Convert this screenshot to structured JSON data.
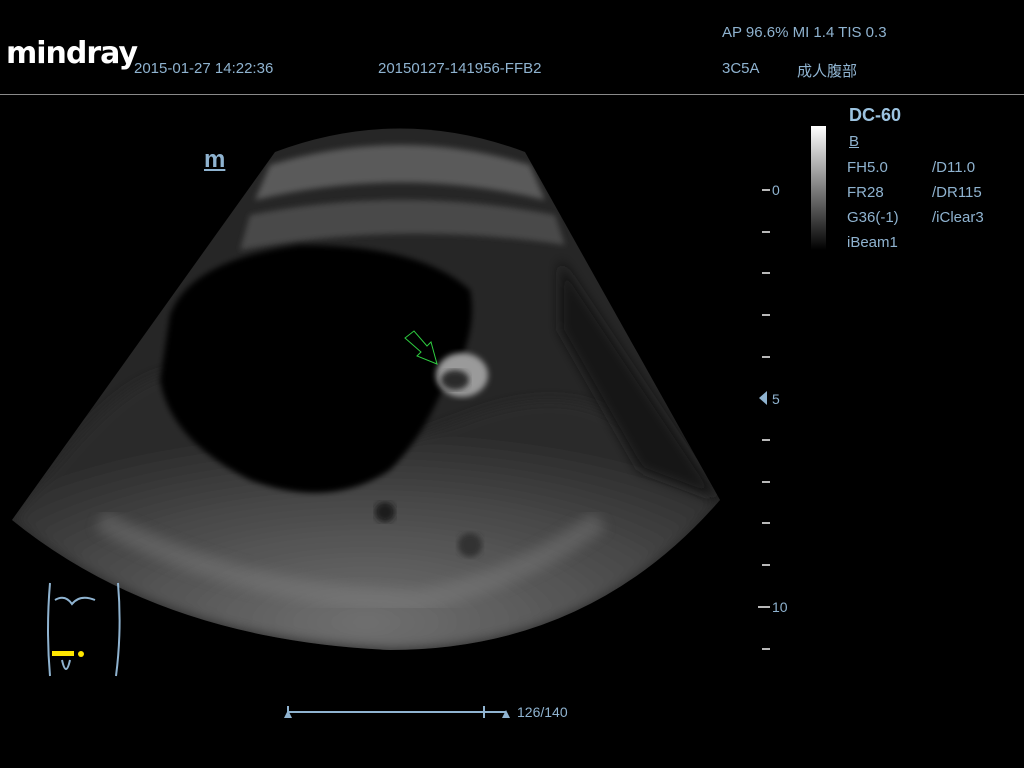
{
  "header": {
    "brand": "mindray",
    "datetime": "2015-01-27 14:22:36",
    "exam_id": "20150127-141956-FFB2",
    "acoustic": "AP 96.6%  MI 1.4 TIS 0.3",
    "probe": "3C5A",
    "preset": "成人腹部"
  },
  "params": {
    "model": "DC-60",
    "mode": "B",
    "left": [
      "FH5.0",
      "FR28",
      "G36(-1)",
      "iBeam1"
    ],
    "right": [
      "/D11.0",
      "/DR115",
      "/iClear3"
    ]
  },
  "image_marker": "m",
  "depth_scale": {
    "labels": [
      "0",
      "5",
      "10"
    ],
    "unit_max": 11
  },
  "cine": {
    "position": 126,
    "total": 140,
    "label": "126/140"
  },
  "colors": {
    "text": "#8fb3d0",
    "arrow": "#2ecc40",
    "probe_marker": "#ffe600"
  }
}
